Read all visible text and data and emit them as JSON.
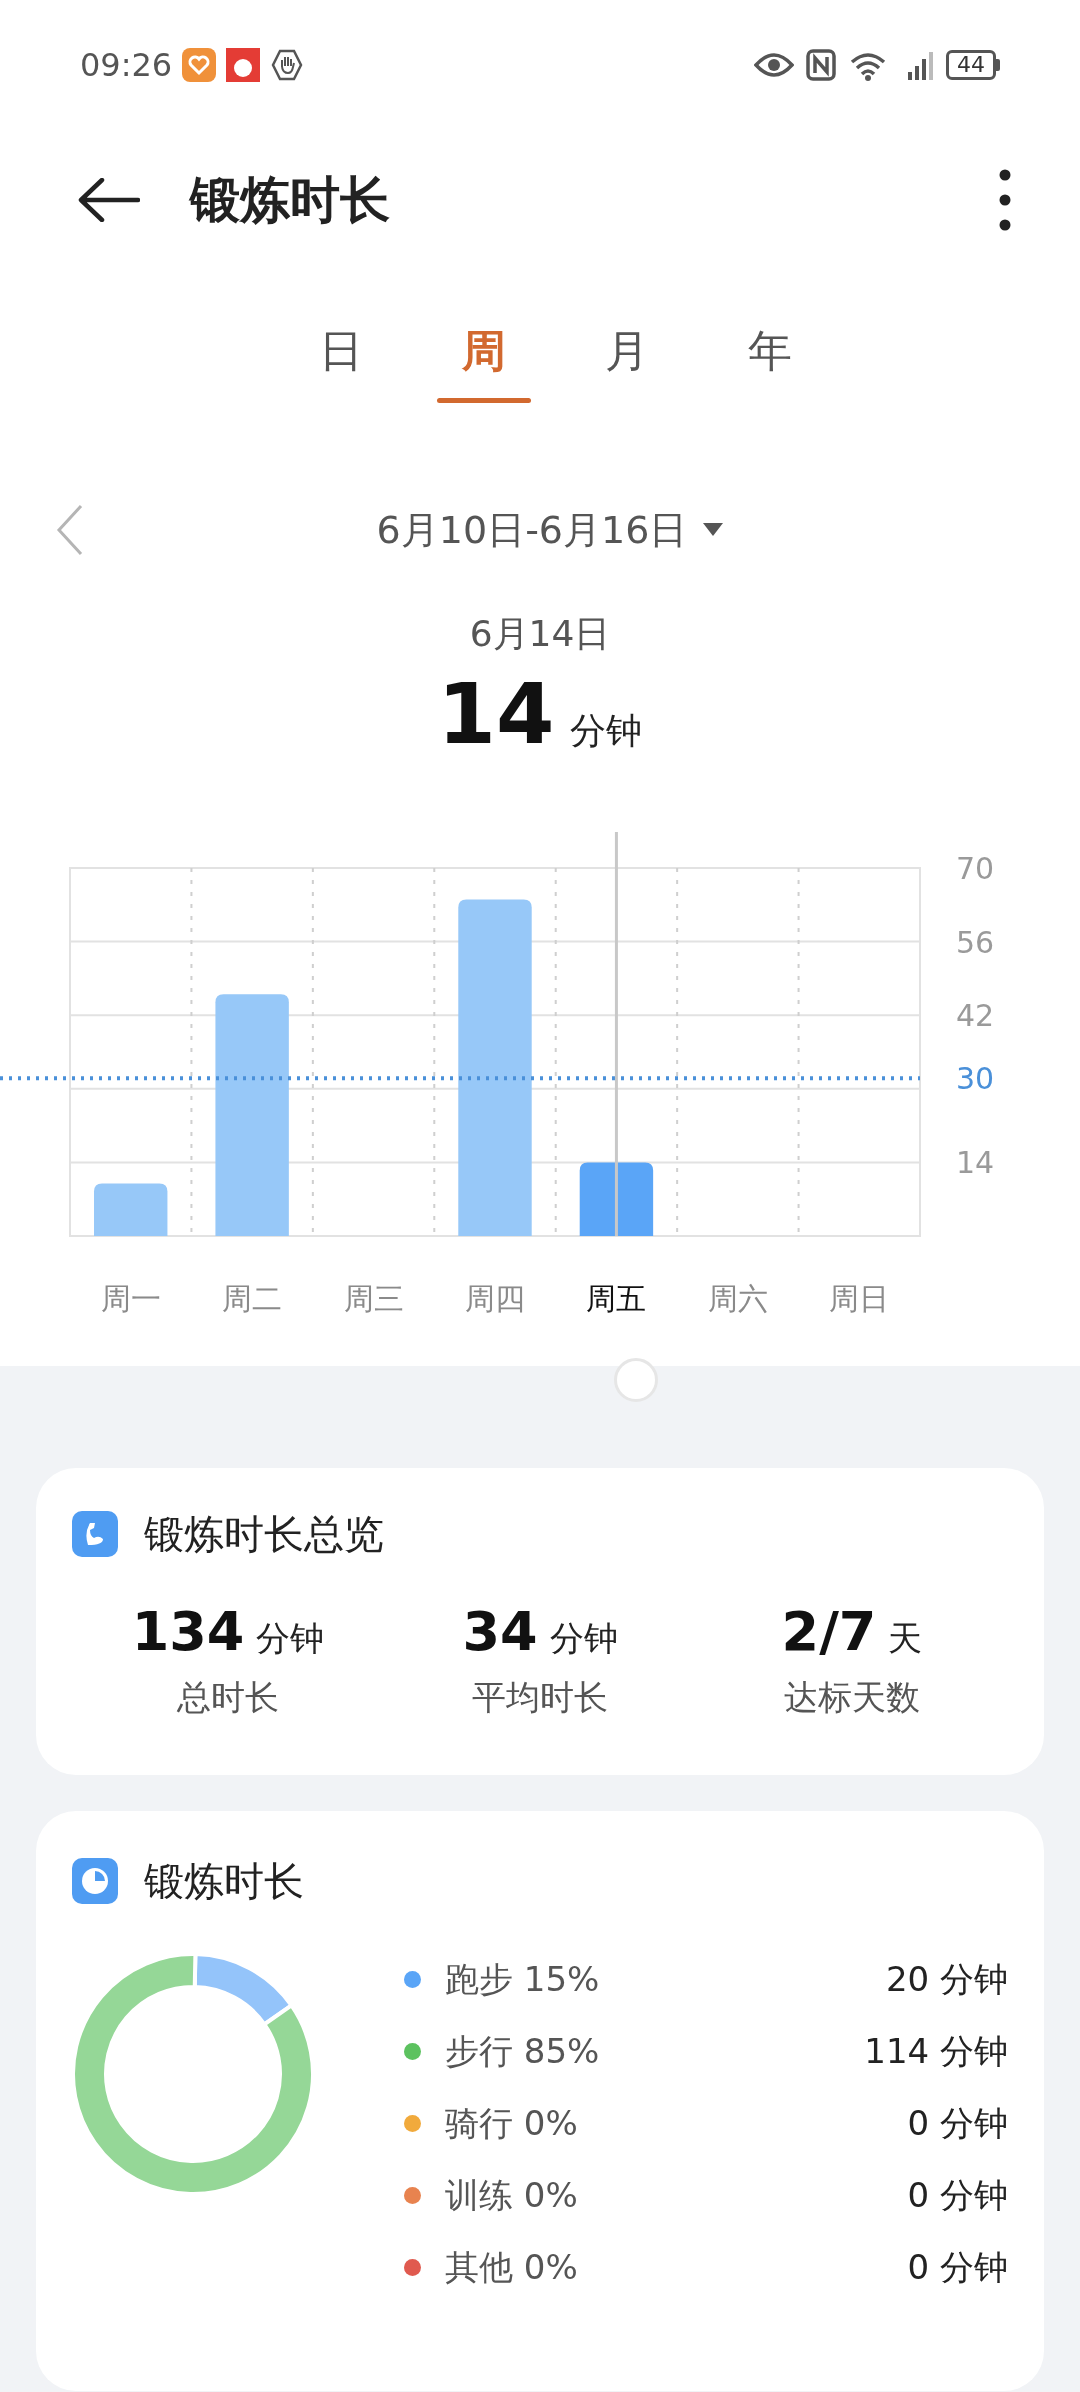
{
  "status_bar": {
    "time": "09:26",
    "battery": "44"
  },
  "header": {
    "title": "锻炼时长"
  },
  "tabs": [
    {
      "label": "日",
      "selected": false
    },
    {
      "label": "周",
      "selected": true
    },
    {
      "label": "月",
      "selected": false
    },
    {
      "label": "年",
      "selected": false
    }
  ],
  "date_range": "6月10日-6月16日",
  "selected_day": {
    "date": "6月14日",
    "value": "14",
    "unit": "分钟"
  },
  "chart": {
    "day_states": [
      {
        "selected": false
      },
      {
        "selected": false
      },
      {
        "selected": false
      },
      {
        "selected": false
      },
      {
        "selected": true
      },
      {
        "selected": false
      },
      {
        "selected": false
      }
    ],
    "chart_data": {
      "type": "bar",
      "categories": [
        "周一",
        "周二",
        "周三",
        "周四",
        "周五",
        "周六",
        "周日"
      ],
      "series": [
        {
          "color": "#97c8f8",
          "values": [
            10,
            46,
            0,
            64,
            null,
            0,
            0
          ]
        },
        {
          "color": "#5aa5f7",
          "values": [
            null,
            null,
            null,
            null,
            14,
            null,
            null
          ]
        }
      ],
      "grid": true,
      "ylim": [
        0,
        70
      ],
      "yticks": [
        14,
        42,
        56,
        70
      ],
      "ref_lines": [
        {
          "axis": "y",
          "value": 30,
          "label": "30",
          "color": "#4a90d9"
        },
        {
          "axis": "x",
          "value": "周五",
          "color": "#c8c8c8"
        }
      ]
    }
  },
  "overview": {
    "title": "锻炼时长总览",
    "stats": [
      {
        "value": "134",
        "unit": "分钟",
        "label": "总时长"
      },
      {
        "value": "34",
        "unit": "分钟",
        "label": "平均时长"
      },
      {
        "value": "2/7",
        "unit": "天",
        "label": "达标天数"
      }
    ]
  },
  "breakdown": {
    "title": "锻炼时长",
    "items": [
      {
        "name": "跑步 15%",
        "minutes": "20 分钟",
        "color": "#5aa5f7"
      },
      {
        "name": "步行 85%",
        "minutes": "114 分钟",
        "color": "#5cc25f"
      },
      {
        "name": "骑行 0%",
        "minutes": "0 分钟",
        "color": "#f1aa3c"
      },
      {
        "name": "训练 0%",
        "minutes": "0 分钟",
        "color": "#e8834f"
      },
      {
        "name": "其他 0%",
        "minutes": "0 分钟",
        "color": "#e05a4f"
      }
    ],
    "chart_data": {
      "type": "donut",
      "values": [
        15,
        85,
        0,
        0,
        0
      ]
    }
  }
}
